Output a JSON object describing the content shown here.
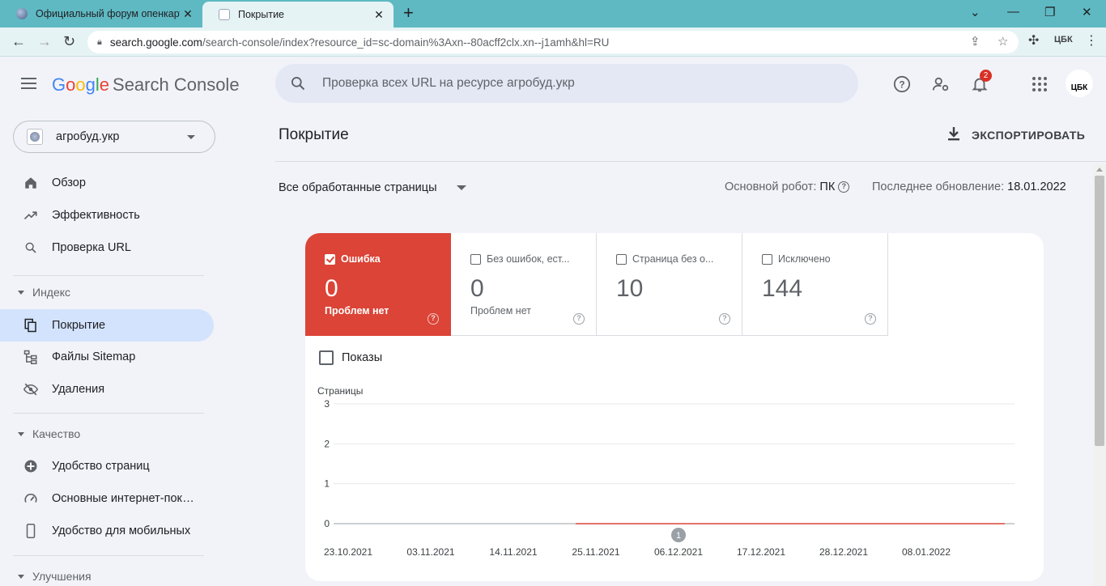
{
  "browser": {
    "tabs": [
      {
        "title": "Официальный форум опенкарт",
        "icon": "globe-icon"
      },
      {
        "title": "Покрытие",
        "icon": "search-console-icon"
      }
    ],
    "url_host": "search.google.com",
    "url_path": "/search-console/index?resource_id=sc-domain%3Axn--80acff2clx.xn--j1amh&hl=RU"
  },
  "header": {
    "logo_google": [
      "G",
      "o",
      "o",
      "g",
      "l",
      "e"
    ],
    "logo_product": "Search Console",
    "search_placeholder": "Проверка всех URL на ресурсе агробуд.укр",
    "notification_count": "2",
    "avatar_text": "ЦБК"
  },
  "sidebar": {
    "property": "агробуд.укр",
    "items_top": [
      {
        "label": "Обзор",
        "icon": "home-icon"
      },
      {
        "label": "Эффективность",
        "icon": "trending-up-icon"
      },
      {
        "label": "Проверка URL",
        "icon": "search-icon"
      }
    ],
    "section_index": "Индекс",
    "items_index": [
      {
        "label": "Покрытие",
        "icon": "file-copy-icon",
        "active": true
      },
      {
        "label": "Файлы Sitemap",
        "icon": "sitemap-icon"
      },
      {
        "label": "Удаления",
        "icon": "visibility-off-icon"
      }
    ],
    "section_quality": "Качество",
    "items_quality": [
      {
        "label": "Удобство страниц",
        "icon": "plus-circle-icon"
      },
      {
        "label": "Основные интернет-показатели",
        "icon": "speed-icon"
      },
      {
        "label": "Удобство для мобильных",
        "icon": "smartphone-icon"
      }
    ],
    "section_improvements": "Улучшения"
  },
  "main": {
    "title": "Покрытие",
    "export_label": "ЭКСПОРТИРОВАТЬ",
    "filter_label": "Все обработанные страницы",
    "robot_label": "Основной робот:",
    "robot_value": "ПК",
    "updated_label": "Последнее обновление:",
    "updated_value": "18.01.2022",
    "metrics": [
      {
        "label": "Ошибка",
        "value": "0",
        "sub": "Проблем нет",
        "checked": true
      },
      {
        "label": "Без ошибок, ест...",
        "value": "0",
        "sub": "Проблем нет",
        "checked": false
      },
      {
        "label": "Страница без о...",
        "value": "10",
        "sub": "",
        "checked": false
      },
      {
        "label": "Исключено",
        "value": "144",
        "sub": "",
        "checked": false
      }
    ],
    "impressions_label": "Показы"
  },
  "chart_data": {
    "type": "line",
    "ylabel": "Страницы",
    "ylim": [
      0,
      3
    ],
    "yticks": [
      0,
      1,
      2,
      3
    ],
    "xticks": [
      "23.10.2021",
      "03.11.2021",
      "14.11.2021",
      "25.11.2021",
      "06.12.2021",
      "17.12.2021",
      "28.12.2021",
      "08.01.2022"
    ],
    "annotation": {
      "label": "1",
      "date": "06.12.2021"
    },
    "series": [
      {
        "color": "#db4437",
        "start": "25.11.2021",
        "end": "18.01.2022",
        "values": [
          0
        ]
      }
    ],
    "grid": true
  }
}
